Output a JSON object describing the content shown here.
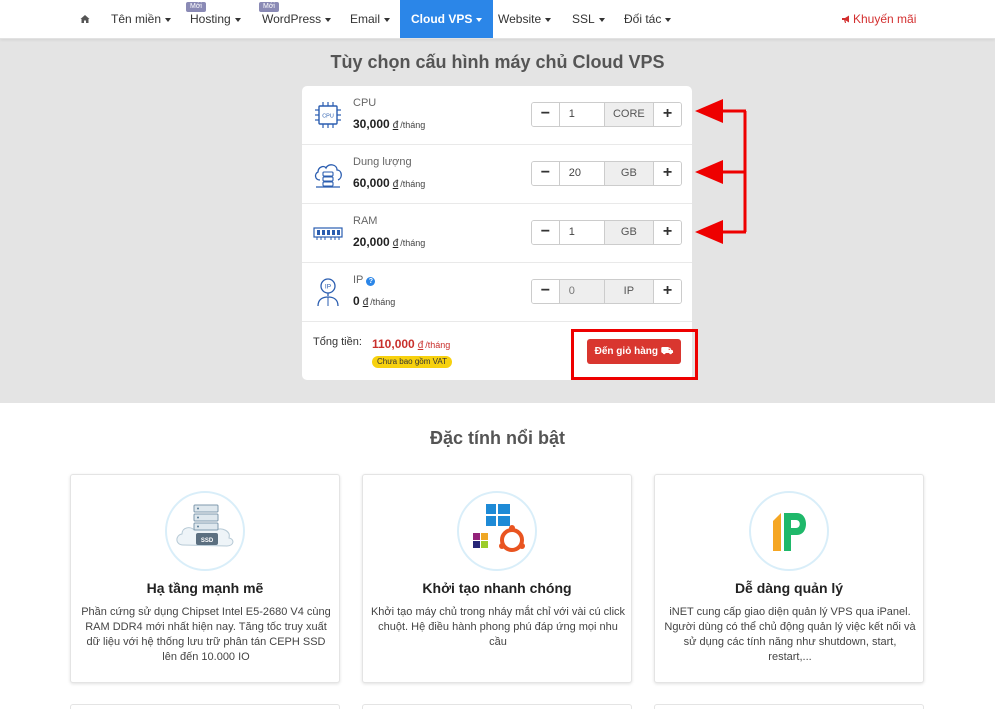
{
  "nav": {
    "items": [
      {
        "label": "Tên miền",
        "badge": ""
      },
      {
        "label": "Hosting",
        "badge": "Mới"
      },
      {
        "label": "WordPress",
        "badge": "Mới"
      },
      {
        "label": "Email",
        "badge": ""
      },
      {
        "label": "Cloud VPS",
        "badge": ""
      },
      {
        "label": "Website",
        "badge": ""
      },
      {
        "label": "SSL",
        "badge": ""
      },
      {
        "label": "Đối tác",
        "badge": ""
      }
    ],
    "promo": "Khuyến mãi"
  },
  "config": {
    "title": "Tùy chọn cấu hình máy chủ Cloud VPS",
    "currency": "đ",
    "per": "/tháng",
    "rows": [
      {
        "name": "CPU",
        "price": "30,000",
        "value": "1",
        "unit": "CORE",
        "icon": "cpu-icon"
      },
      {
        "name": "Dung lượng",
        "price": "60,000",
        "value": "20",
        "unit": "GB",
        "icon": "cloud-storage-icon"
      },
      {
        "name": "RAM",
        "price": "20,000",
        "value": "1",
        "unit": "GB",
        "icon": "ram-icon"
      },
      {
        "name": "IP",
        "price": "0",
        "value": "0",
        "unit": "IP",
        "icon": "ip-icon"
      }
    ],
    "minus": "−",
    "plus": "+",
    "help": "?",
    "total_label": "Tổng tiền:",
    "total_value": "110,000",
    "vat_note": "Chưa bao gồm VAT",
    "cart_button": "Đến giỏ hàng"
  },
  "features": {
    "title": "Đặc tính nổi bật",
    "cards": [
      {
        "name": "Hạ tầng mạnh mẽ",
        "desc": "Phần cứng sử dụng Chipset Intel E5-2680 V4 cùng RAM DDR4 mới nhất hiện nay. Tăng tốc truy xuất dữ liệu với hệ thống lưu trữ phân tán CEPH SSD lên đến 10.000 IO",
        "icon": "ssd-server-icon",
        "icon_text": "SSD"
      },
      {
        "name": "Khởi tạo nhanh chóng",
        "desc": "Khởi tạo máy chủ trong nháy mắt chỉ với vài cú click chuột. Hệ điều hành phong phú đáp ứng mọi nhu cầu",
        "icon": "os-logos-icon"
      },
      {
        "name": "Dễ dàng quản lý",
        "desc": "iNET cung cấp giao diện quản lý VPS qua iPanel. Người dùng có thể chủ động quản lý việc kết nối và sử dụng các tính năng như shutdown, start, restart,...",
        "icon": "ipanel-logo-icon"
      }
    ]
  },
  "colors": {
    "nav_active": "#2b86e8",
    "cart": "#d9362f",
    "price_total": "#c9302c",
    "annotation": "#ee0000"
  }
}
